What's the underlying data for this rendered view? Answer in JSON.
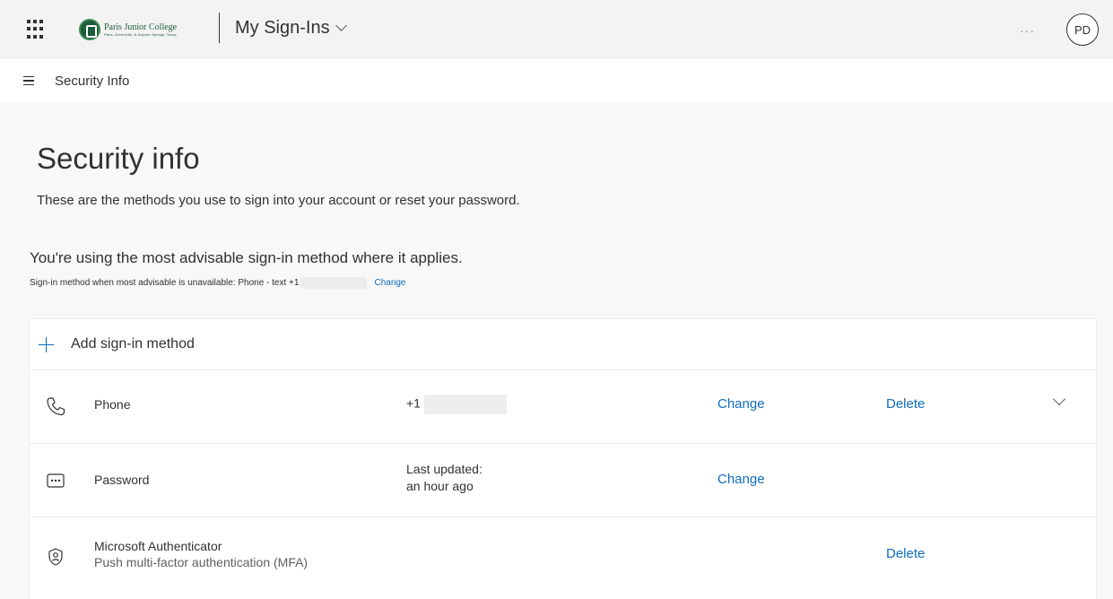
{
  "header": {
    "logo": {
      "name": "Paris Junior College",
      "tagline": "Paris, Greenville, & Sulphur Springs, Texas",
      "color": "#1f5c3a"
    },
    "app_title": "My Sign-Ins",
    "more_label": "···",
    "avatar_initials": "PD"
  },
  "nav": {
    "title": "Security Info"
  },
  "main": {
    "title": "Security info",
    "description": "These are the methods you use to sign into your account or reset your password.",
    "advisory": "You're using the most advisable sign-in method where it applies.",
    "default_method_prefix": "Sign-in method when most advisable is unavailable: Phone - text +1",
    "default_method_change": "Change"
  },
  "methods_card": {
    "add_label": "Add sign-in method",
    "methods": [
      {
        "icon": "phone-icon",
        "name": "Phone",
        "detail_prefix": "+1",
        "change_label": "Change",
        "delete_label": "Delete"
      },
      {
        "icon": "password-icon",
        "name": "Password",
        "detail_line1": "Last updated:",
        "detail_line2": "an hour ago",
        "change_label": "Change"
      },
      {
        "icon": "authenticator-icon",
        "name": "Microsoft Authenticator",
        "subtitle": "Push multi-factor authentication (MFA)",
        "delete_label": "Delete"
      }
    ]
  },
  "colors": {
    "accent": "#0f6cbd",
    "text": "#323130",
    "background": "#f3f3f3"
  }
}
